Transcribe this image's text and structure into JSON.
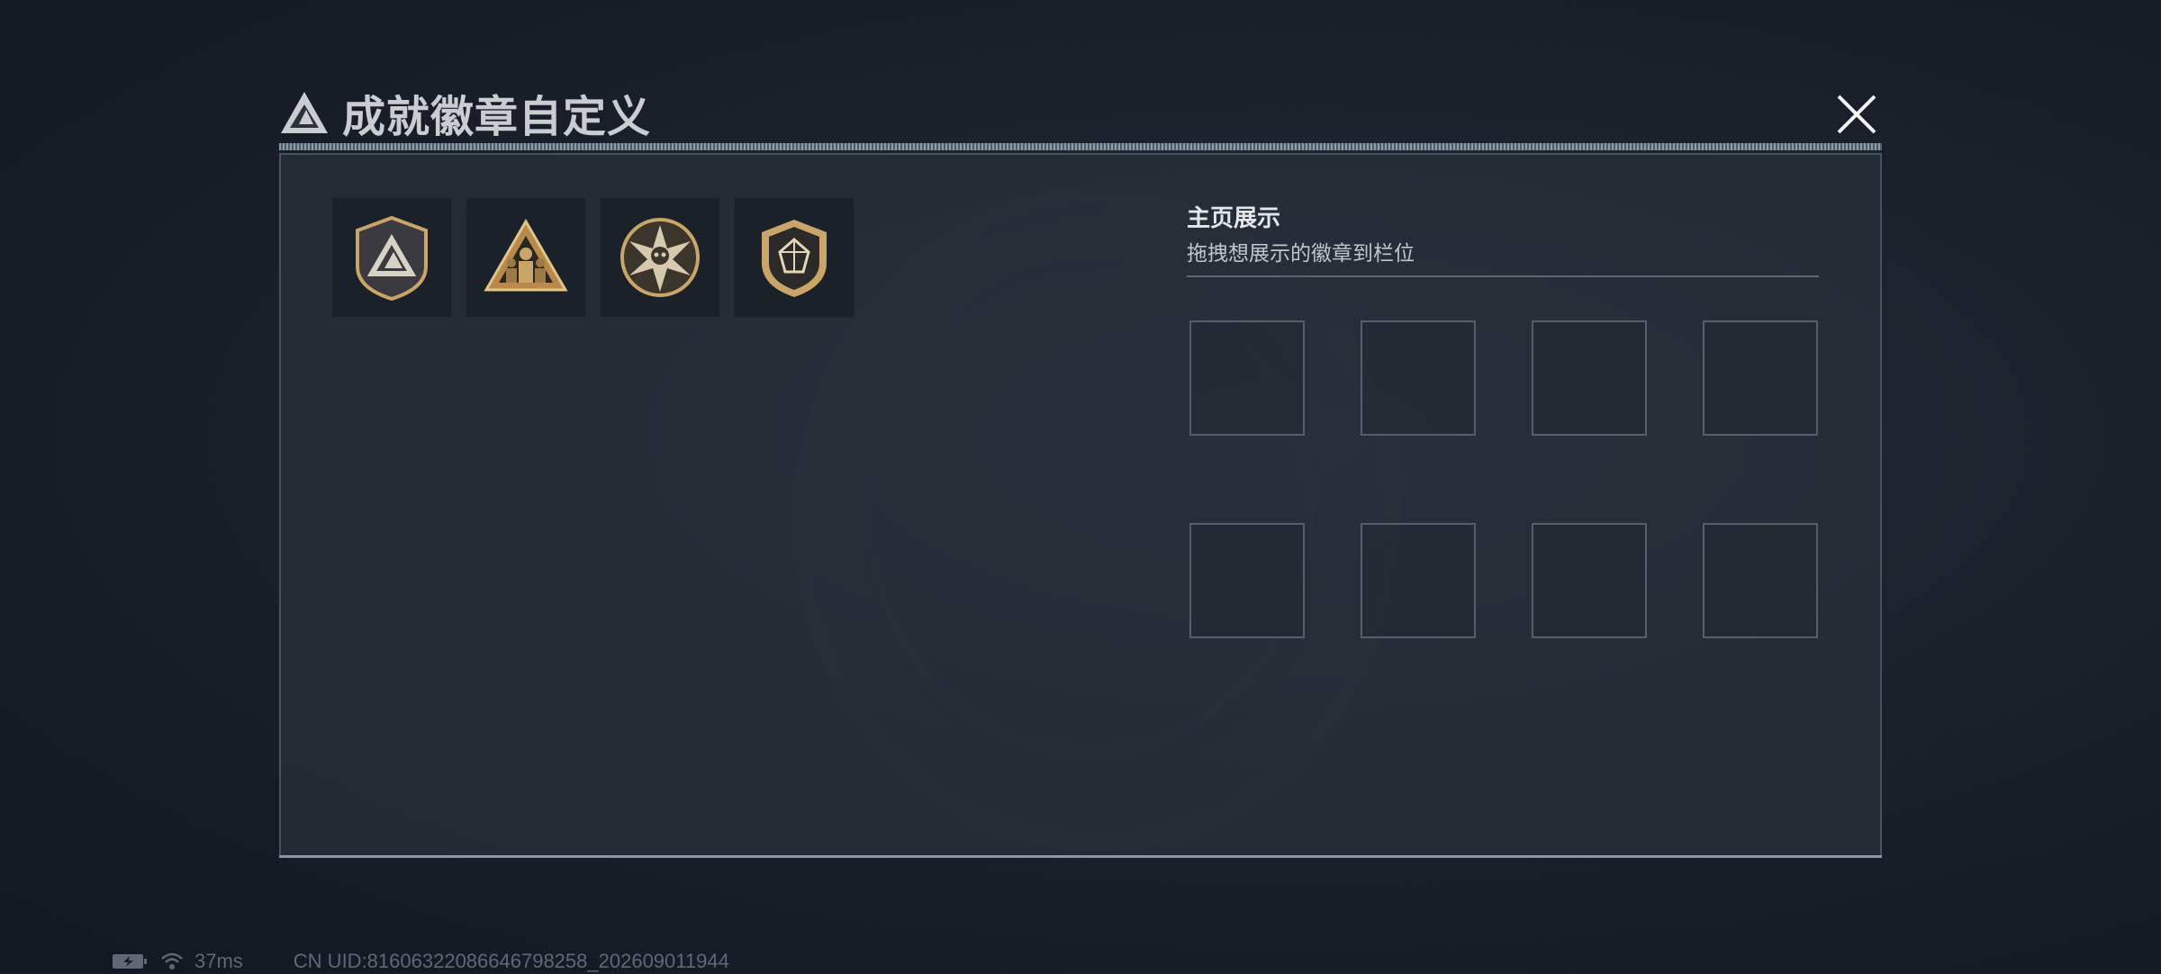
{
  "header": {
    "title": "成就徽章自定义"
  },
  "badges": [
    {
      "name": "shield-triangle-badge"
    },
    {
      "name": "soldiers-triangle-badge"
    },
    {
      "name": "star-skull-badge"
    },
    {
      "name": "gem-shield-badge"
    }
  ],
  "display_section": {
    "title": "主页展示",
    "subtitle": "拖拽想展示的徽章到栏位",
    "slots": 8
  },
  "status": {
    "ping": "37ms",
    "uid": "CN UID:816063220866467982​58_202609011944"
  },
  "colors": {
    "accent_gold": "#c9a56a",
    "panel": "#28303a"
  }
}
